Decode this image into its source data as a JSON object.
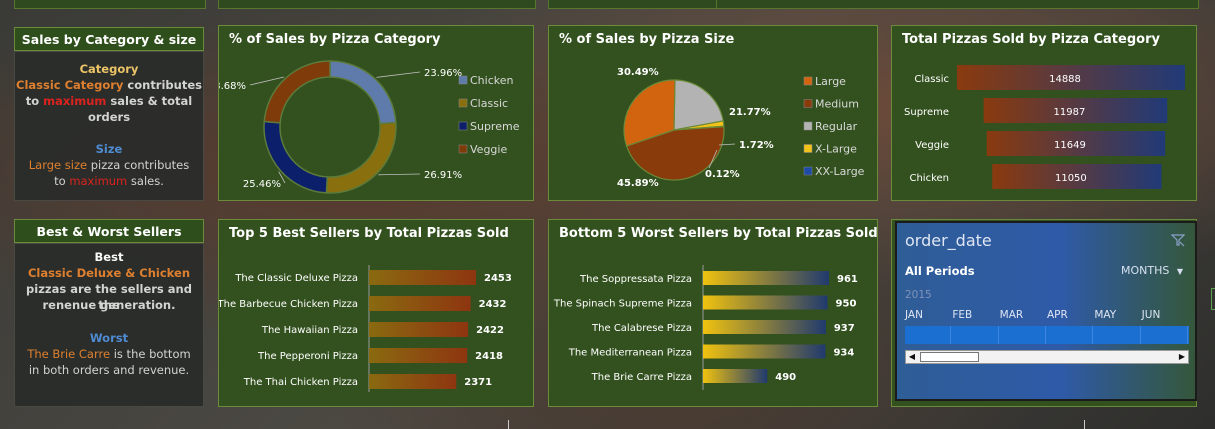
{
  "colors": {
    "panel_bg": "#33511f",
    "chicken": "#5e7bab",
    "classic": "#8a6f0e",
    "supreme": "#0c1f6b",
    "veggie": "#7f3b0a",
    "large": "#d3640f",
    "medium": "#8a3b0b",
    "regular": "#b3b3b3",
    "xlarge": "#f2c21a",
    "xxlarge": "#1e4aa8"
  },
  "left_top": {
    "title": "Sales by Category & size",
    "category_heading": "Category",
    "cat_line1_highlight": "Classic Category",
    "cat_line1_rest": " contributes",
    "cat_line2_pre": "to ",
    "cat_line2_highlight": "maximum",
    "cat_line2_rest": " sales & total",
    "cat_line3": "orders",
    "size_heading": "Size",
    "size_line1_highlight": "Large size",
    "size_line1_rest": " pizza contributes",
    "size_line2_pre": "to ",
    "size_line2_highlight": "maximum",
    "size_line2_rest": " sales."
  },
  "left_bottom": {
    "title": "Best & Worst Sellers",
    "best_heading": "Best",
    "best_highlight": "Classic Deluxe & Chicken",
    "best_line2": "pizzas are the sellers and the",
    "best_line3": "renenue generation.",
    "worst_heading": "Worst",
    "worst_highlight": "The Brie Carre",
    "worst_line1_rest": " is the bottom",
    "worst_line2": "in both orders and revenue."
  },
  "chart_data": [
    {
      "type": "pie",
      "title": "% of Sales by Pizza Category",
      "variant": "donut",
      "categories": [
        "Chicken",
        "Classic",
        "Supreme",
        "Veggie"
      ],
      "values": [
        23.96,
        26.91,
        25.46,
        23.68
      ],
      "labels": [
        "23.96%",
        "26.91%",
        "25.46%",
        "23.68%"
      ],
      "legend": "right"
    },
    {
      "type": "pie",
      "title": "% of Sales by Pizza Size",
      "categories": [
        "Large",
        "Medium",
        "Regular",
        "X-Large",
        "XX-Large"
      ],
      "values": [
        30.49,
        45.89,
        21.77,
        1.72,
        0.12
      ],
      "labels": [
        "30.49%",
        "45.89%",
        "21.77%",
        "1.72%",
        "0.12%"
      ],
      "legend": "right"
    },
    {
      "type": "bar",
      "title": "Total Pizzas Sold by Pizza Category",
      "orientation": "horizontal",
      "categories": [
        "Classic",
        "Supreme",
        "Veggie",
        "Chicken"
      ],
      "values": [
        14888,
        11987,
        11649,
        11050
      ],
      "labels": [
        "14888",
        "11987",
        "11649",
        "11050"
      ]
    },
    {
      "type": "bar",
      "title": "Top 5 Best Sellers by Total Pizzas Sold",
      "orientation": "horizontal",
      "categories": [
        "The Classic Deluxe Pizza",
        "The Barbecue Chicken Pizza",
        "The Hawaiian Pizza",
        "The Pepperoni Pizza",
        "The Thai Chicken Pizza"
      ],
      "values": [
        2453,
        2432,
        2422,
        2418,
        2371
      ],
      "labels": [
        "2453",
        "2432",
        "2422",
        "2418",
        "2371"
      ]
    },
    {
      "type": "bar",
      "title": "Bottom 5 Worst Sellers by Total Pizzas Sold",
      "orientation": "horizontal",
      "categories": [
        "The Soppressata Pizza",
        "The Spinach Supreme Pizza",
        "The Calabrese Pizza",
        "The Mediterranean Pizza",
        "The Brie Carre Pizza"
      ],
      "values": [
        961,
        950,
        937,
        934,
        490
      ],
      "labels": [
        "961",
        "950",
        "937",
        "934",
        "490"
      ]
    }
  ],
  "slicer": {
    "title": "order_date",
    "clear_filter_icon": "filter-clear-icon",
    "periods_label": "All Periods",
    "level_label": "MONTHS",
    "year": "2015",
    "months": [
      "JAN",
      "FEB",
      "MAR",
      "APR",
      "MAY",
      "JUN"
    ],
    "scroll_fraction": 0.08
  }
}
